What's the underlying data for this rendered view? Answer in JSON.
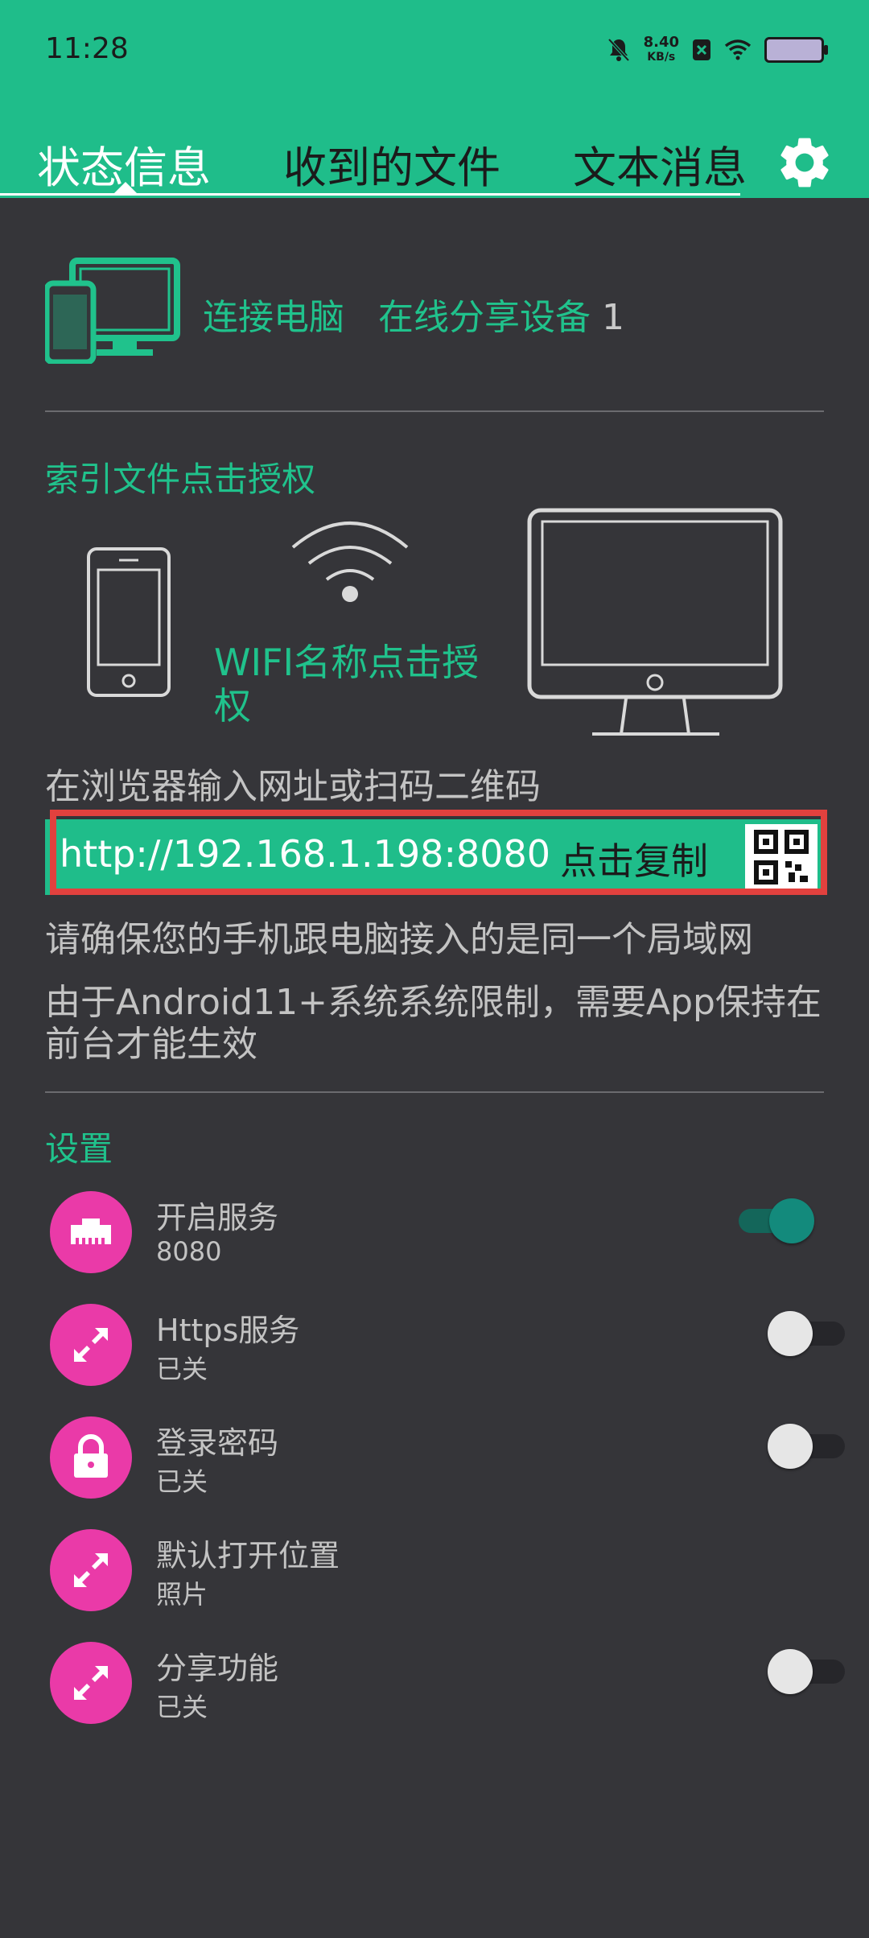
{
  "status_bar": {
    "time": "11:28",
    "net_speed_value": "8.40",
    "net_speed_unit": "KB/s"
  },
  "tabs": [
    {
      "label": "状态信息",
      "active": true
    },
    {
      "label": "收到的文件",
      "active": false
    },
    {
      "label": "文本消息",
      "active": false
    }
  ],
  "connect": {
    "label": "连接电脑",
    "online_label": "在线分享设备",
    "online_count": "1"
  },
  "index": {
    "label": "索引文件点击授权",
    "wifi_label": "WIFI名称点击授权"
  },
  "browser": {
    "hint": "在浏览器输入网址或扫码二维码",
    "url": "http://192.168.1.198:8080",
    "copy_label": "点击复制",
    "note_same_lan": "请确保您的手机跟电脑接入的是同一个局域网",
    "note_android": "由于Android11+系统系统限制，需要App保持在前台才能生效"
  },
  "settings": {
    "title": "设置",
    "items": [
      {
        "title": "开启服务",
        "subtitle": "8080",
        "icon": "ethernet-icon",
        "toggle": "on"
      },
      {
        "title": "Https服务",
        "subtitle": "已关",
        "icon": "expand-arrows-icon",
        "toggle": "off"
      },
      {
        "title": "登录密码",
        "subtitle": "已关",
        "icon": "lock-icon",
        "toggle": "off"
      },
      {
        "title": "默认打开位置",
        "subtitle": "照片",
        "icon": "expand-arrows-icon",
        "toggle": null
      },
      {
        "title": "分享功能",
        "subtitle": "已关",
        "icon": "expand-arrows-icon",
        "toggle": "off"
      }
    ]
  },
  "colors": {
    "accent": "#1fbd8a",
    "background": "#353539",
    "icon_bg": "#ea3aa8",
    "highlight": "#e2413e"
  }
}
